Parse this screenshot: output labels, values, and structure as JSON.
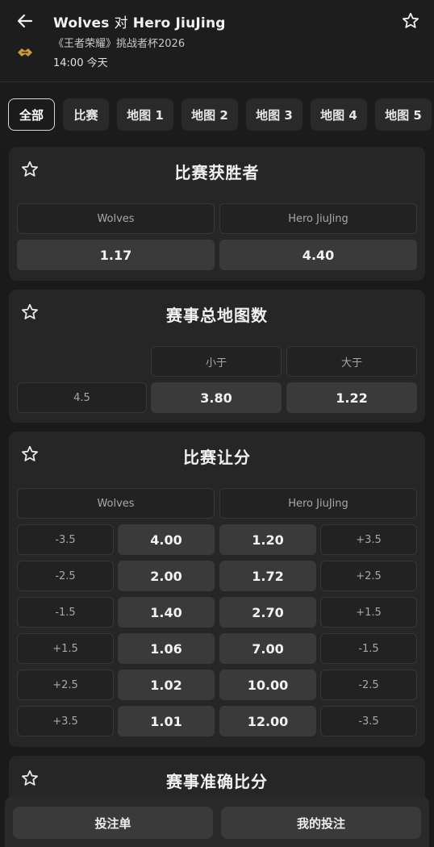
{
  "header": {
    "team_home": "Wolves",
    "vs": "对",
    "team_away": "Hero JiuJing",
    "tournament": "《王者荣耀》挑战者杯2026",
    "time": "14:00 今天"
  },
  "tabs": [
    "全部",
    "比赛",
    "地图 1",
    "地图 2",
    "地图 3",
    "地图 4",
    "地图 5"
  ],
  "match_winner": {
    "title": "比赛获胜者",
    "home": "Wolves",
    "away": "Hero JiuJing",
    "home_odds": "1.17",
    "away_odds": "4.40"
  },
  "total_maps": {
    "title": "赛事总地图数",
    "under_label": "小于",
    "over_label": "大于",
    "line": "4.5",
    "under_odds": "3.80",
    "over_odds": "1.22"
  },
  "handicap": {
    "title": "比赛让分",
    "home": "Wolves",
    "away": "Hero JiuJing",
    "rows": [
      {
        "home_line": "-3.5",
        "home_odds": "4.00",
        "away_odds": "1.20",
        "away_line": "+3.5"
      },
      {
        "home_line": "-2.5",
        "home_odds": "2.00",
        "away_odds": "1.72",
        "away_line": "+2.5"
      },
      {
        "home_line": "-1.5",
        "home_odds": "1.40",
        "away_odds": "2.70",
        "away_line": "+1.5"
      },
      {
        "home_line": "+1.5",
        "home_odds": "1.06",
        "away_odds": "7.00",
        "away_line": "-1.5"
      },
      {
        "home_line": "+2.5",
        "home_odds": "1.02",
        "away_odds": "10.00",
        "away_line": "-2.5"
      },
      {
        "home_line": "+3.5",
        "home_odds": "1.01",
        "away_odds": "12.00",
        "away_line": "-3.5"
      }
    ]
  },
  "exact_score": {
    "title": "赛事准确比分"
  },
  "bottom": {
    "betslip": "投注单",
    "my_bets": "我的投注"
  }
}
